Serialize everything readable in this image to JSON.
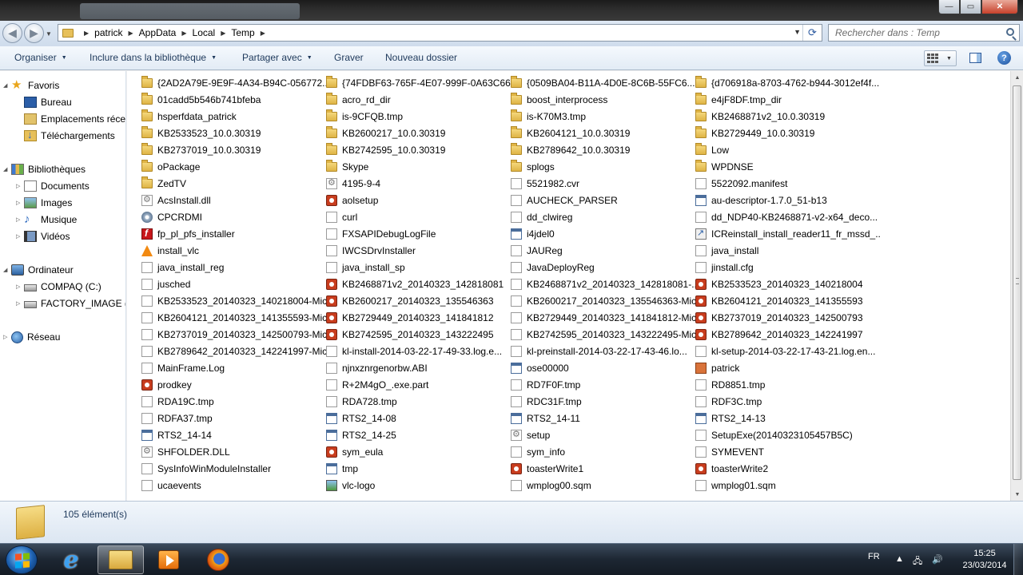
{
  "window": {
    "minimize_glyph": "—",
    "maximize_glyph": "▭",
    "close_glyph": "✕"
  },
  "address": {
    "crumbs": [
      "patrick",
      "AppData",
      "Local",
      "Temp"
    ],
    "search_placeholder": "Rechercher dans : Temp"
  },
  "toolbar": {
    "organize": "Organiser",
    "include_library": "Inclure dans la bibliothèque",
    "share": "Partager avec",
    "burn": "Graver",
    "new_folder": "Nouveau dossier"
  },
  "nav": {
    "favorites": "Favoris",
    "desktop": "Bureau",
    "recent_places": "Emplacements récents",
    "downloads": "Téléchargements",
    "libraries": "Bibliothèques",
    "documents": "Documents",
    "images": "Images",
    "music": "Musique",
    "videos": "Vidéos",
    "computer": "Ordinateur",
    "drive_c": "COMPAQ (C:)",
    "drive_d": "FACTORY_IMAGE (D:)",
    "network": "Réseau"
  },
  "files": [
    [
      {
        "name": "{2AD2A79E-9E9F-4A34-B94C-056772...",
        "icon": "folder"
      },
      {
        "name": "01cadd5b546b741bfeba",
        "icon": "folder"
      },
      {
        "name": "hsperfdata_patrick",
        "icon": "folder"
      },
      {
        "name": "KB2533523_10.0.30319",
        "icon": "folder"
      },
      {
        "name": "KB2737019_10.0.30319",
        "icon": "folder"
      },
      {
        "name": "oPackage",
        "icon": "folder"
      },
      {
        "name": "ZedTV",
        "icon": "folder"
      },
      {
        "name": "AcsInstall.dll",
        "icon": "cfg"
      },
      {
        "name": "CPCRDMI",
        "icon": "disc"
      },
      {
        "name": "fp_pl_pfs_installer",
        "icon": "flash"
      },
      {
        "name": "install_vlc",
        "icon": "vlc"
      },
      {
        "name": "java_install_reg",
        "icon": "doc"
      },
      {
        "name": "jusched",
        "icon": "doc"
      },
      {
        "name": "KB2533523_20140323_140218004-Mic...",
        "icon": "doc"
      },
      {
        "name": "KB2604121_20140323_141355593-Mic...",
        "icon": "doc"
      },
      {
        "name": "KB2737019_20140323_142500793-Mic...",
        "icon": "doc"
      },
      {
        "name": "KB2789642_20140323_142241997-Mic...",
        "icon": "doc"
      },
      {
        "name": "MainFrame.Log",
        "icon": "doc"
      },
      {
        "name": "prodkey",
        "icon": "office"
      },
      {
        "name": "RDA19C.tmp",
        "icon": "doc"
      },
      {
        "name": "RDFA37.tmp",
        "icon": "doc"
      },
      {
        "name": "RTS2_14-14",
        "icon": "app"
      },
      {
        "name": "SHFOLDER.DLL",
        "icon": "cfg"
      },
      {
        "name": "SysInfoWinModuleInstaller",
        "icon": "doc"
      },
      {
        "name": "ucaevents",
        "icon": "doc"
      }
    ],
    [
      {
        "name": "{74FDBF63-765F-4E07-999F-0A63C66...",
        "icon": "folder"
      },
      {
        "name": "acro_rd_dir",
        "icon": "folder"
      },
      {
        "name": "is-9CFQB.tmp",
        "icon": "folder"
      },
      {
        "name": "KB2600217_10.0.30319",
        "icon": "folder"
      },
      {
        "name": "KB2742595_10.0.30319",
        "icon": "folder"
      },
      {
        "name": "Skype",
        "icon": "folder"
      },
      {
        "name": "4195-9-4",
        "icon": "cfg"
      },
      {
        "name": "aolsetup",
        "icon": "office"
      },
      {
        "name": "curl",
        "icon": "doc"
      },
      {
        "name": "FXSAPIDebugLogFile",
        "icon": "doc"
      },
      {
        "name": "IWCSDrvInstaller",
        "icon": "doc"
      },
      {
        "name": "java_install_sp",
        "icon": "doc"
      },
      {
        "name": "KB2468871v2_20140323_142818081",
        "icon": "office"
      },
      {
        "name": "KB2600217_20140323_135546363",
        "icon": "office"
      },
      {
        "name": "KB2729449_20140323_141841812",
        "icon": "office"
      },
      {
        "name": "KB2742595_20140323_143222495",
        "icon": "office"
      },
      {
        "name": "kl-install-2014-03-22-17-49-33.log.e...",
        "icon": "doc"
      },
      {
        "name": "njnxznrgenorbw.ABI",
        "icon": "doc"
      },
      {
        "name": "R+2M4gO_.exe.part",
        "icon": "doc"
      },
      {
        "name": "RDA728.tmp",
        "icon": "doc"
      },
      {
        "name": "RTS2_14-08",
        "icon": "app"
      },
      {
        "name": "RTS2_14-25",
        "icon": "app"
      },
      {
        "name": "sym_eula",
        "icon": "office"
      },
      {
        "name": "tmp",
        "icon": "app"
      },
      {
        "name": "vlc-logo",
        "icon": "pic"
      }
    ],
    [
      {
        "name": "{0509BA04-B11A-4D0E-8C6B-55FC6...",
        "icon": "folder"
      },
      {
        "name": "boost_interprocess",
        "icon": "folder"
      },
      {
        "name": "is-K70M3.tmp",
        "icon": "folder"
      },
      {
        "name": "KB2604121_10.0.30319",
        "icon": "folder"
      },
      {
        "name": "KB2789642_10.0.30319",
        "icon": "folder"
      },
      {
        "name": "splogs",
        "icon": "folder"
      },
      {
        "name": "5521982.cvr",
        "icon": "doc"
      },
      {
        "name": "AUCHECK_PARSER",
        "icon": "doc"
      },
      {
        "name": "dd_clwireg",
        "icon": "doc"
      },
      {
        "name": "i4jdel0",
        "icon": "app"
      },
      {
        "name": "JAUReg",
        "icon": "doc"
      },
      {
        "name": "JavaDeployReg",
        "icon": "doc"
      },
      {
        "name": "KB2468871v2_20140323_142818081-...",
        "icon": "doc"
      },
      {
        "name": "KB2600217_20140323_135546363-Mic...",
        "icon": "doc"
      },
      {
        "name": "KB2729449_20140323_141841812-Mic...",
        "icon": "doc"
      },
      {
        "name": "KB2742595_20140323_143222495-Mic...",
        "icon": "doc"
      },
      {
        "name": "kl-preinstall-2014-03-22-17-43-46.lo...",
        "icon": "doc"
      },
      {
        "name": "ose00000",
        "icon": "app"
      },
      {
        "name": "RD7F0F.tmp",
        "icon": "doc"
      },
      {
        "name": "RDC31F.tmp",
        "icon": "doc"
      },
      {
        "name": "RTS2_14-11",
        "icon": "app"
      },
      {
        "name": "setup",
        "icon": "cfg"
      },
      {
        "name": "sym_info",
        "icon": "doc"
      },
      {
        "name": "toasterWrite1",
        "icon": "office"
      },
      {
        "name": "wmplog00.sqm",
        "icon": "doc"
      }
    ],
    [
      {
        "name": "{d706918a-8703-4762-b944-3012ef4f...",
        "icon": "folder"
      },
      {
        "name": "e4jF8DF.tmp_dir",
        "icon": "folder"
      },
      {
        "name": "KB2468871v2_10.0.30319",
        "icon": "folder"
      },
      {
        "name": "KB2729449_10.0.30319",
        "icon": "folder"
      },
      {
        "name": "Low",
        "icon": "folder"
      },
      {
        "name": "WPDNSE",
        "icon": "folder"
      },
      {
        "name": "5522092.manifest",
        "icon": "doc"
      },
      {
        "name": "au-descriptor-1.7.0_51-b13",
        "icon": "app"
      },
      {
        "name": "dd_NDP40-KB2468871-v2-x64_deco...",
        "icon": "doc"
      },
      {
        "name": "ICReinstall_install_reader11_fr_mssd_...",
        "icon": "shortcut"
      },
      {
        "name": "java_install",
        "icon": "doc"
      },
      {
        "name": "jinstall.cfg",
        "icon": "doc"
      },
      {
        "name": "KB2533523_20140323_140218004",
        "icon": "office"
      },
      {
        "name": "KB2604121_20140323_141355593",
        "icon": "office"
      },
      {
        "name": "KB2737019_20140323_142500793",
        "icon": "office"
      },
      {
        "name": "KB2789642_20140323_142241997",
        "icon": "office"
      },
      {
        "name": "kl-setup-2014-03-22-17-43-21.log.en...",
        "icon": "doc"
      },
      {
        "name": "patrick",
        "icon": "person"
      },
      {
        "name": "RD8851.tmp",
        "icon": "doc"
      },
      {
        "name": "RDF3C.tmp",
        "icon": "doc"
      },
      {
        "name": "RTS2_14-13",
        "icon": "app"
      },
      {
        "name": "SetupExe(20140323105457B5C)",
        "icon": "doc"
      },
      {
        "name": "SYMEVENT",
        "icon": "doc"
      },
      {
        "name": "toasterWrite2",
        "icon": "office"
      },
      {
        "name": "wmplog01.sqm",
        "icon": "doc"
      }
    ]
  ],
  "status": {
    "count": "105 élément(s)"
  },
  "taskbar": {
    "language": "FR",
    "time": "15:25",
    "date": "23/03/2014"
  },
  "colors": {
    "command_text": "#1e395b",
    "folder": "#e7c05a",
    "taskbar": "#1d2733"
  }
}
